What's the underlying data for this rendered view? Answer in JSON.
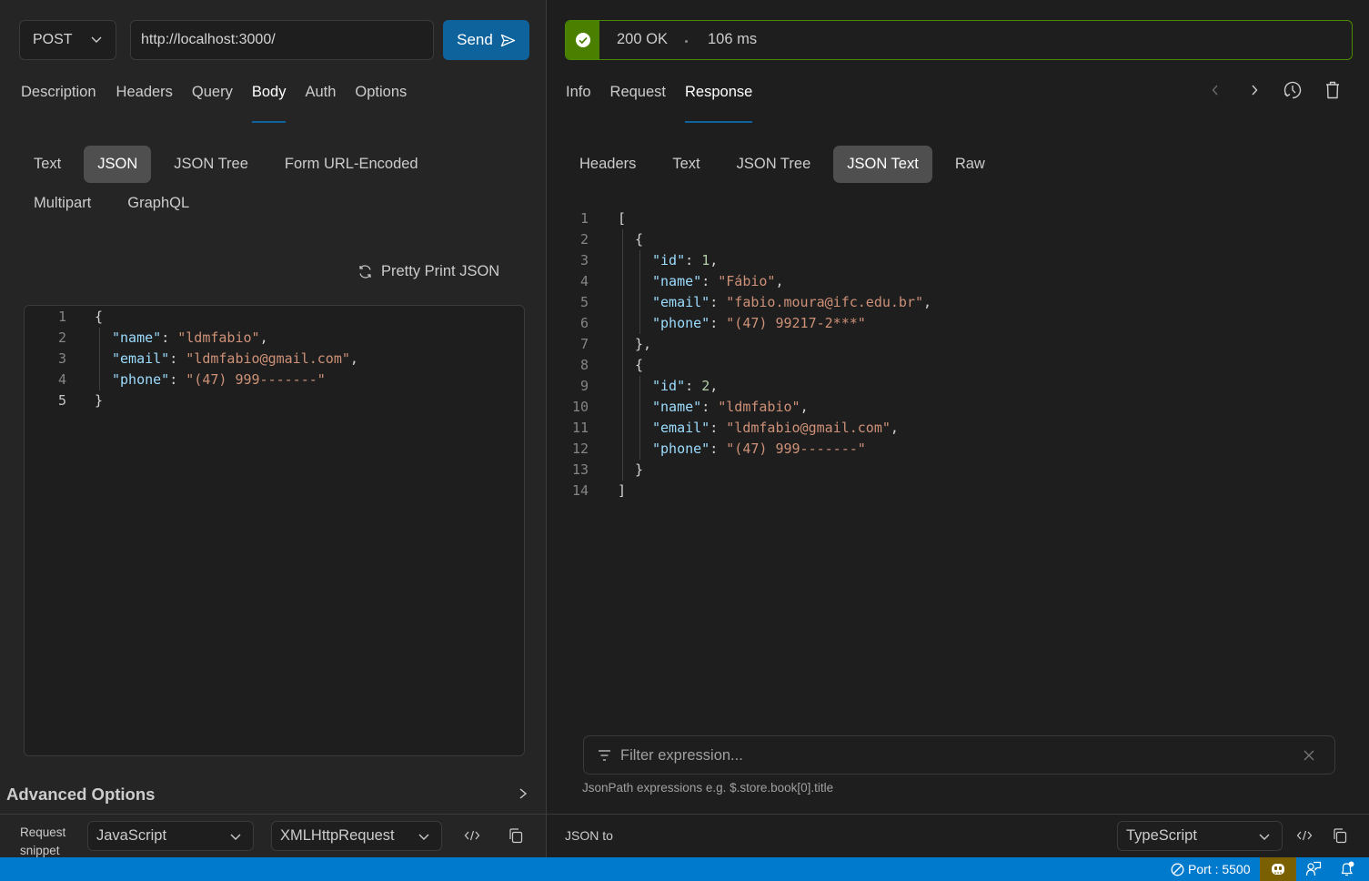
{
  "request": {
    "method": "POST",
    "url": "http://localhost:3000/",
    "send_label": "Send",
    "tabs": [
      {
        "label": "Description",
        "active": false
      },
      {
        "label": "Headers",
        "active": false
      },
      {
        "label": "Query",
        "active": false
      },
      {
        "label": "Body",
        "active": true
      },
      {
        "label": "Auth",
        "active": false
      },
      {
        "label": "Options",
        "active": false
      }
    ],
    "body_types_row1": [
      {
        "label": "Text",
        "active": false
      },
      {
        "label": "JSON",
        "active": true
      },
      {
        "label": "JSON Tree",
        "active": false
      },
      {
        "label": "Form URL-Encoded",
        "active": false
      }
    ],
    "body_types_row2": [
      {
        "label": "Multipart",
        "active": false
      },
      {
        "label": "GraphQL",
        "active": false
      }
    ],
    "pretty_print_label": "Pretty Print JSON",
    "body_lines": [
      {
        "num": "1",
        "tokens": [
          {
            "t": "{",
            "c": "p"
          }
        ]
      },
      {
        "num": "2",
        "tokens": [
          {
            "t": "\"name\"",
            "c": "k"
          },
          {
            "t": ": ",
            "c": "p"
          },
          {
            "t": "\"ldmfabio\"",
            "c": "s"
          },
          {
            "t": ",",
            "c": "p"
          }
        ]
      },
      {
        "num": "3",
        "tokens": [
          {
            "t": "\"email\"",
            "c": "k"
          },
          {
            "t": ": ",
            "c": "p"
          },
          {
            "t": "\"ldmfabio@gmail.com\"",
            "c": "s"
          },
          {
            "t": ",",
            "c": "p"
          }
        ]
      },
      {
        "num": "4",
        "tokens": [
          {
            "t": "\"phone\"",
            "c": "k"
          },
          {
            "t": ": ",
            "c": "p"
          },
          {
            "t": "\"(47) 999-------\"",
            "c": "s"
          }
        ]
      },
      {
        "num": "5",
        "tokens": [
          {
            "t": "}",
            "c": "p"
          }
        ]
      }
    ],
    "advanced_options_label": "Advanced Options",
    "snippet_label_line1": "Request",
    "snippet_label_line2": "snippet",
    "snippet_language": "JavaScript",
    "snippet_library": "XMLHttpRequest"
  },
  "response": {
    "status": "200 OK",
    "time": "106 ms",
    "status_color": "#4a7f00",
    "tabs": [
      {
        "label": "Info",
        "active": false
      },
      {
        "label": "Request",
        "active": false
      },
      {
        "label": "Response",
        "active": true
      }
    ],
    "view_types": [
      {
        "label": "Headers",
        "active": false
      },
      {
        "label": "Text",
        "active": false
      },
      {
        "label": "JSON Tree",
        "active": false
      },
      {
        "label": "JSON Text",
        "active": true
      },
      {
        "label": "Raw",
        "active": false
      }
    ],
    "body_lines": [
      {
        "num": "1",
        "indent": 0,
        "tokens": [
          {
            "t": "[",
            "c": "p"
          }
        ]
      },
      {
        "num": "2",
        "indent": 1,
        "tokens": [
          {
            "t": "{",
            "c": "p"
          }
        ]
      },
      {
        "num": "3",
        "indent": 2,
        "tokens": [
          {
            "t": "\"id\"",
            "c": "k"
          },
          {
            "t": ": ",
            "c": "p"
          },
          {
            "t": "1",
            "c": "n"
          },
          {
            "t": ",",
            "c": "p"
          }
        ]
      },
      {
        "num": "4",
        "indent": 2,
        "tokens": [
          {
            "t": "\"name\"",
            "c": "k"
          },
          {
            "t": ": ",
            "c": "p"
          },
          {
            "t": "\"Fábio\"",
            "c": "s"
          },
          {
            "t": ",",
            "c": "p"
          }
        ]
      },
      {
        "num": "5",
        "indent": 2,
        "tokens": [
          {
            "t": "\"email\"",
            "c": "k"
          },
          {
            "t": ": ",
            "c": "p"
          },
          {
            "t": "\"fabio.moura@ifc.edu.br\"",
            "c": "s"
          },
          {
            "t": ",",
            "c": "p"
          }
        ]
      },
      {
        "num": "6",
        "indent": 2,
        "tokens": [
          {
            "t": "\"phone\"",
            "c": "k"
          },
          {
            "t": ": ",
            "c": "p"
          },
          {
            "t": "\"(47) 99217-2***\"",
            "c": "s"
          }
        ]
      },
      {
        "num": "7",
        "indent": 1,
        "tokens": [
          {
            "t": "},",
            "c": "p"
          }
        ]
      },
      {
        "num": "8",
        "indent": 1,
        "tokens": [
          {
            "t": "{",
            "c": "p"
          }
        ]
      },
      {
        "num": "9",
        "indent": 2,
        "tokens": [
          {
            "t": "\"id\"",
            "c": "k"
          },
          {
            "t": ": ",
            "c": "p"
          },
          {
            "t": "2",
            "c": "n"
          },
          {
            "t": ",",
            "c": "p"
          }
        ]
      },
      {
        "num": "10",
        "indent": 2,
        "tokens": [
          {
            "t": "\"name\"",
            "c": "k"
          },
          {
            "t": ": ",
            "c": "p"
          },
          {
            "t": "\"ldmfabio\"",
            "c": "s"
          },
          {
            "t": ",",
            "c": "p"
          }
        ]
      },
      {
        "num": "11",
        "indent": 2,
        "tokens": [
          {
            "t": "\"email\"",
            "c": "k"
          },
          {
            "t": ": ",
            "c": "p"
          },
          {
            "t": "\"ldmfabio@gmail.com\"",
            "c": "s"
          },
          {
            "t": ",",
            "c": "p"
          }
        ]
      },
      {
        "num": "12",
        "indent": 2,
        "tokens": [
          {
            "t": "\"phone\"",
            "c": "k"
          },
          {
            "t": ": ",
            "c": "p"
          },
          {
            "t": "\"(47) 999-------\"",
            "c": "s"
          }
        ]
      },
      {
        "num": "13",
        "indent": 1,
        "tokens": [
          {
            "t": "}",
            "c": "p"
          }
        ]
      },
      {
        "num": "14",
        "indent": 0,
        "tokens": [
          {
            "t": "]",
            "c": "p"
          }
        ]
      }
    ],
    "filter_placeholder": "Filter expression...",
    "filter_hint": "JsonPath expressions e.g. $.store.book[0].title",
    "json_to_label": "JSON to",
    "json_to_language": "TypeScript"
  },
  "statusbar": {
    "port_label": "Port : 5500",
    "accent": "#007acc"
  }
}
